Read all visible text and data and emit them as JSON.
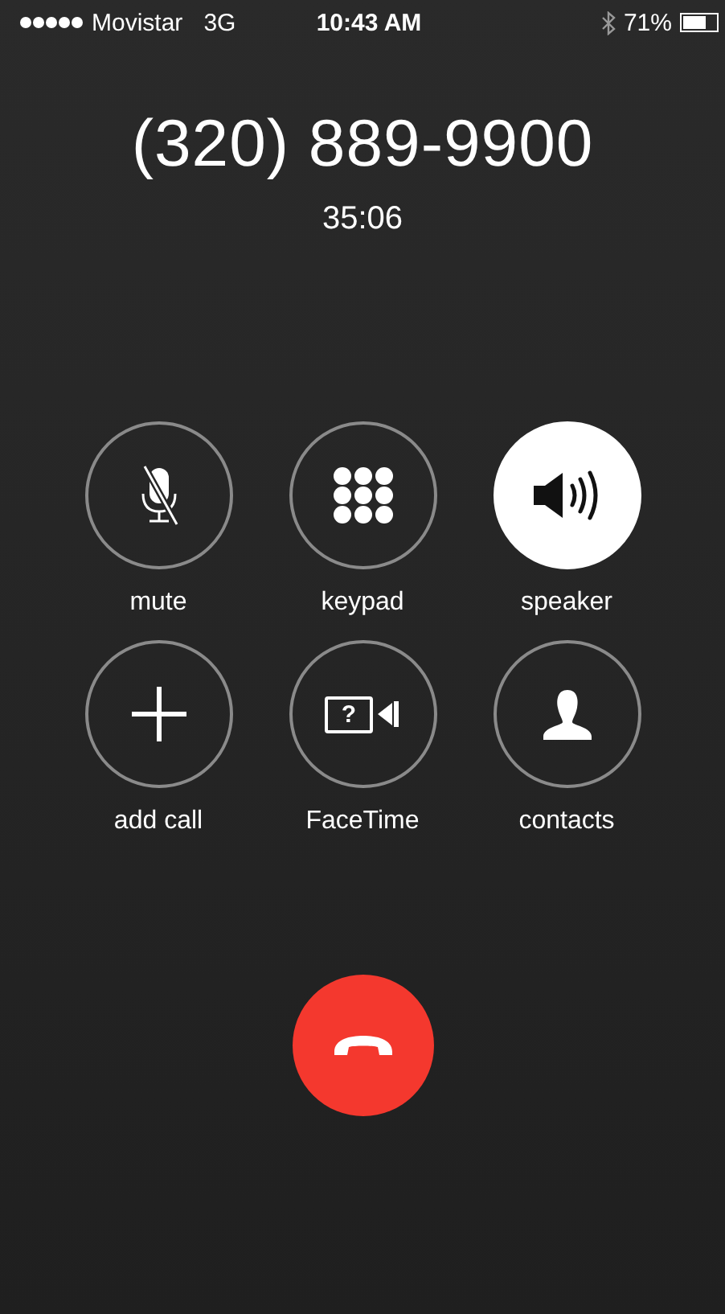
{
  "status_bar": {
    "carrier": "Movistar",
    "network": "3G",
    "time": "10:43 AM",
    "battery": "71%"
  },
  "call": {
    "number": "(320) 889-9900",
    "duration": "35:06"
  },
  "controls": [
    {
      "kind": "mute",
      "label": "mute",
      "on": false
    },
    {
      "kind": "keypad",
      "label": "keypad",
      "on": false
    },
    {
      "kind": "speaker",
      "label": "speaker",
      "on": true
    },
    {
      "kind": "add",
      "label": "add call",
      "on": false
    },
    {
      "kind": "facetime",
      "label": "FaceTime",
      "on": false,
      "glyph": "?"
    },
    {
      "kind": "contacts",
      "label": "contacts",
      "on": false
    }
  ]
}
